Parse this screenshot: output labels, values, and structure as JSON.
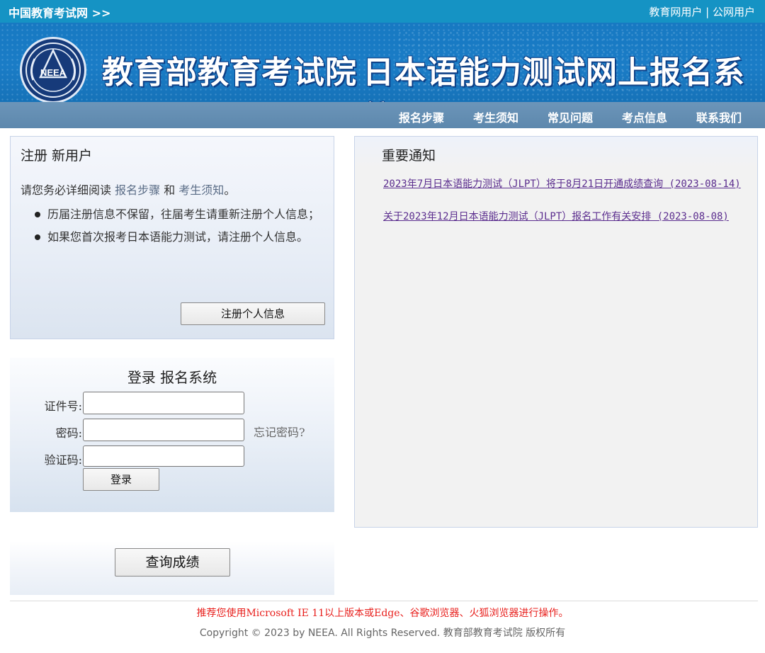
{
  "topbar": {
    "site_link": "中国教育考试网 >>",
    "edu_user": "教育网用户",
    "separator": " | ",
    "public_user": "公网用户"
  },
  "banner": {
    "logo_text": "NEEA",
    "title_org": "教育部教育考试院",
    "title_system": "日本语能力测试网上报名系统"
  },
  "nav": {
    "items": [
      "报名步骤",
      "考生须知",
      "常见问题",
      "考点信息",
      "联系我们"
    ]
  },
  "register": {
    "heading": "注册 新用户",
    "intro_prefix": "请您务必详细阅读 ",
    "intro_link1": "报名步骤",
    "intro_and": " 和 ",
    "intro_link2": "考生须知",
    "intro_suffix": "。",
    "bullets": [
      "历届注册信息不保留，往届考生请重新注册个人信息；",
      "如果您首次报考日本语能力测试，请注册个人信息。"
    ],
    "button": "注册个人信息"
  },
  "login": {
    "heading": "登录 报名系统",
    "id_label": "证件号:",
    "password_label": "密码:",
    "captcha_label": "验证码:",
    "id_value": "",
    "password_value": "",
    "captcha_value": "",
    "forgot": "忘记密码?",
    "button": "登录"
  },
  "score": {
    "button": "查询成绩"
  },
  "notices": {
    "heading": "重要通知",
    "items": [
      "2023年7月日本语能力测试（JLPT）将于8月21日开通成绩查询 (2023-08-14)",
      "关于2023年12月日本语能力测试（JLPT）报名工作有关安排 (2023-08-08)"
    ]
  },
  "footer": {
    "browser_notice": "推荐您使用Microsoft IE 11以上版本或Edge、谷歌浏览器、火狐浏览器进行操作。",
    "copyright": "Copyright © 2023 by NEEA. All Rights Reserved. 教育部教育考试院 版权所有"
  },
  "colors": {
    "topbar": "#1593c4",
    "banner": "#1779c2",
    "nav": "#6c95b9",
    "notice_link": "#5b2d8e",
    "footer_warning": "#e8201d"
  }
}
